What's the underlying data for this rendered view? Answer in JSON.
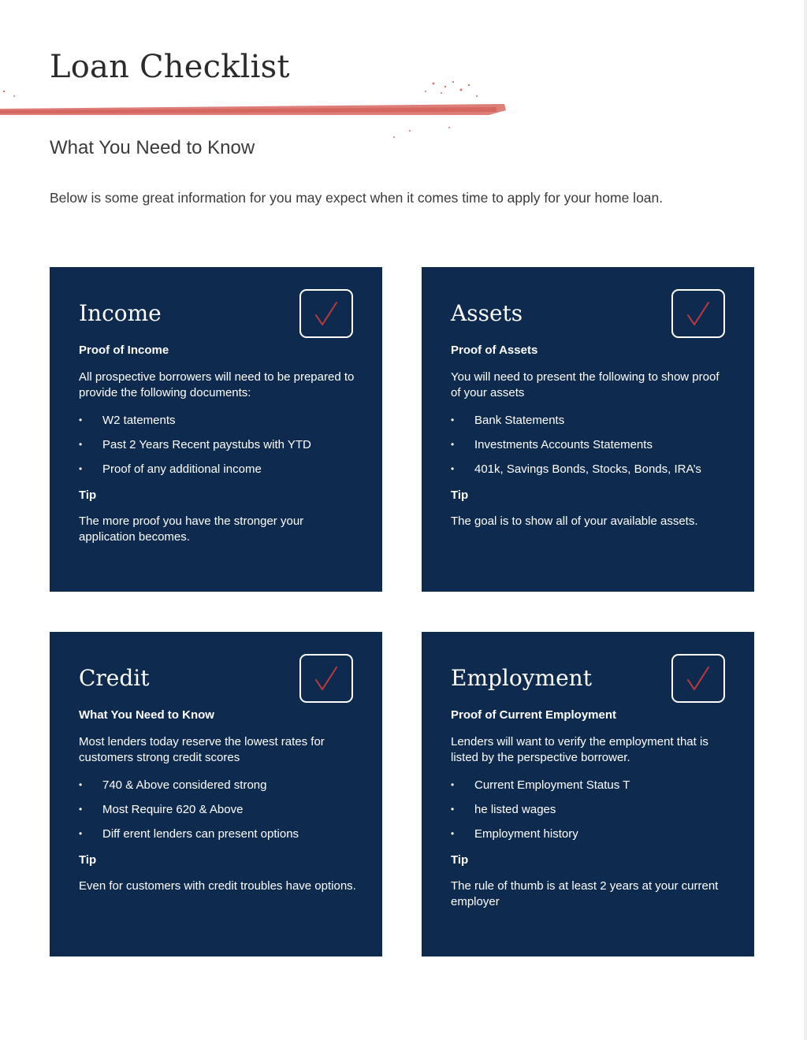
{
  "header": {
    "title": "Loan Checklist",
    "subtitle": "What You Need to Know",
    "intro": "Below is some great information for you may expect when it comes time to apply for your home loan."
  },
  "colors": {
    "card_background": "#0e2a4f",
    "accent_red": "#d9706a",
    "check_mark": "#c0393b"
  },
  "cards": [
    {
      "heading": "Income",
      "label": "Proof of Income",
      "description": "All prospective borrowers will need to be prepared to provide the following documents:",
      "items": [
        "W2 tatements",
        "Past 2 Years Recent paystubs with YTD",
        "Proof of any additional income"
      ],
      "tip_label": "Tip",
      "tip": "The more proof you have the stronger your application becomes."
    },
    {
      "heading": "Assets",
      "label": "Proof of Assets",
      "description": "You will need to present the following to show proof of your assets",
      "items": [
        "Bank Statements",
        "Investments Accounts Statements",
        "401k, Savings Bonds, Stocks, Bonds, IRA’s"
      ],
      "tip_label": "Tip",
      "tip": "The goal is to show all of your available assets."
    },
    {
      "heading": "Credit",
      "label": "What You Need to Know",
      "description": "Most lenders today reserve the lowest rates for customers strong credit scores",
      "items": [
        "740 & Above considered strong",
        "Most Require 620 & Above",
        "Diff erent lenders can present options"
      ],
      "tip_label": "Tip",
      "tip": "Even for customers with credit troubles have options."
    },
    {
      "heading": "Employment",
      "label": "Proof of Current Employment",
      "description": "Lenders will want to verify the employment that is listed by the perspective borrower.",
      "items": [
        "Current Employment Status T",
        "he listed wages",
        "Employment history"
      ],
      "tip_label": "Tip",
      "tip": "The rule of thumb is at least 2 years at your current employer"
    }
  ]
}
